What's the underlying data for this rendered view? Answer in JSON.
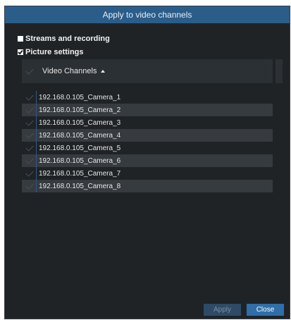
{
  "dialog": {
    "title": "Apply to video channels"
  },
  "options": [
    {
      "label": "Streams and recording",
      "checked": false
    },
    {
      "label": "Picture settings",
      "checked": true
    }
  ],
  "table": {
    "header": "Video Channels",
    "sort_icon": "sort-ascending-icon",
    "rows": [
      {
        "label": "192.168.0.105_Camera_1"
      },
      {
        "label": "192.168.0.105_Camera_2"
      },
      {
        "label": "192.168.0.105_Camera_3"
      },
      {
        "label": "192.168.0.105_Camera_4"
      },
      {
        "label": "192.168.0.105_Camera_5"
      },
      {
        "label": "192.168.0.105_Camera_6"
      },
      {
        "label": "192.168.0.105_Camera_7"
      },
      {
        "label": "192.168.0.105_Camera_8"
      }
    ]
  },
  "footer": {
    "apply_label": "Apply",
    "close_label": "Close"
  },
  "colors": {
    "background": "#1f2326",
    "titlebar": "#2a5d8a",
    "accent": "#2f6ea8"
  }
}
